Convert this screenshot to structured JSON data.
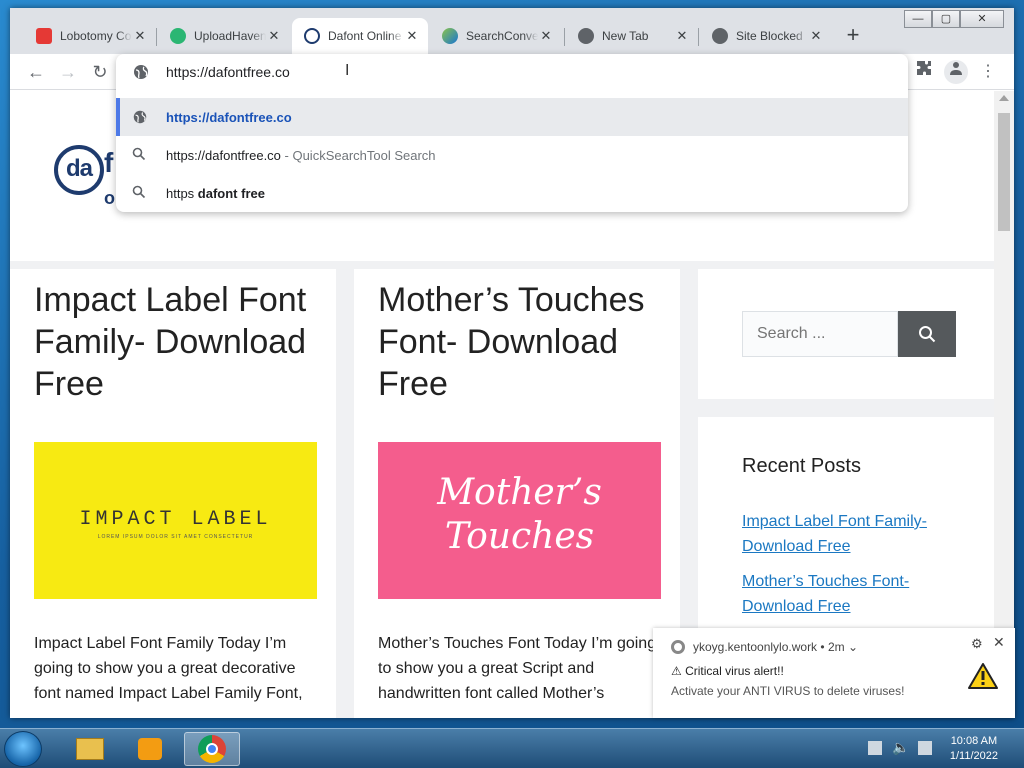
{
  "browser": {
    "tabs": [
      {
        "label": "Lobotomy Co",
        "icon": "lock-red-icon",
        "color": "#e53935"
      },
      {
        "label": "UploadHaven",
        "icon": "uploadhaven-icon",
        "color": "#2bb673"
      },
      {
        "label": "Dafont Online",
        "icon": "dafont-icon",
        "color": "#1e3b6e",
        "active": true
      },
      {
        "label": "SearchConvert",
        "icon": "searchconvert-icon",
        "color": "#4caf50"
      },
      {
        "label": "New Tab",
        "icon": "globe-icon",
        "color": "#5f6368"
      },
      {
        "label": "Site Blocked",
        "icon": "globe-icon",
        "color": "#5f6368"
      }
    ],
    "new_tab_label": "+",
    "window_buttons": {
      "minimize": "—",
      "maximize": "▢",
      "close": "✕"
    }
  },
  "omnibox": {
    "value": "https://dafontfree.co",
    "suggestions": [
      {
        "text": "https://dafontfree.co",
        "suffix": "",
        "icon": "globe-icon",
        "selected": true
      },
      {
        "text": "https://dafontfree.co",
        "suffix": " - QuickSearchTool Search",
        "icon": "search-icon"
      },
      {
        "text_plain": "https ",
        "text_bold": "dafont free",
        "icon": "search-icon"
      }
    ]
  },
  "site": {
    "logo_text": "da",
    "logo_tail": "f",
    "logo_tail2": "o",
    "posts": [
      {
        "title": "Impact Label Font Family- Download Free",
        "image_text": "IMPACT LABEL",
        "image_subtext": "LOREM IPSUM DOLOR SIT AMET CONSECTETUR",
        "image_color": "#f7ea12",
        "excerpt": "Impact Label Font Family Today I’m going to show you a great decorative font named Impact Label Family Font,"
      },
      {
        "title": "Mother’s Touches Font- Download Free",
        "image_text_line1": "Mother’s",
        "image_text_line2": "Touches",
        "image_color": "#f45d8d",
        "excerpt": "Mother’s Touches Font Today I’m going to show you a great Script and handwritten font called Mother’s"
      }
    ],
    "sidebar": {
      "search_placeholder": "Search ...",
      "recent_title": "Recent Posts",
      "recent_links": [
        "Impact Label Font Family- Download Free",
        "Mother’s Touches Font- Download Free"
      ]
    }
  },
  "notification": {
    "origin": "ykoyg.kentoonlylo.work",
    "age": "• 2m ⌄",
    "title": "⚠ Critical virus alert!!",
    "body": "Activate your ANTI VIRUS to delete viruses!"
  },
  "taskbar": {
    "time": "10:08 AM",
    "date": "1/11/2022"
  }
}
